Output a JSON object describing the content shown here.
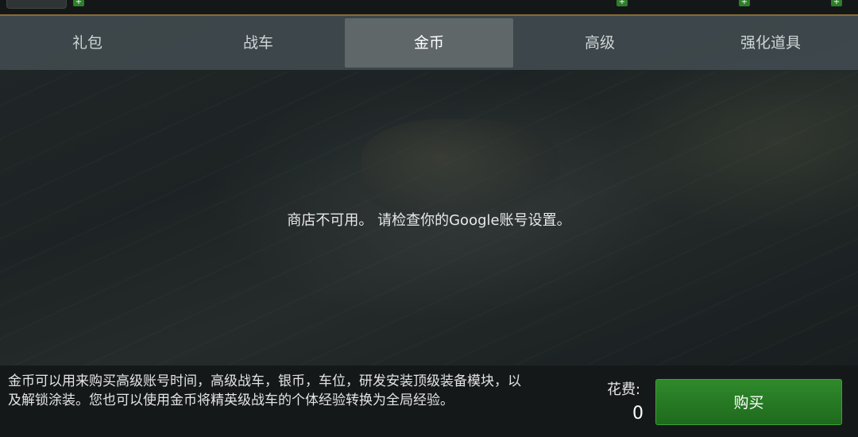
{
  "tabs": [
    {
      "label": "礼包"
    },
    {
      "label": "战车"
    },
    {
      "label": "金币"
    },
    {
      "label": "高级"
    },
    {
      "label": "强化道具"
    }
  ],
  "active_tab": "金币",
  "message": "商店不可用。 请检查你的Google账号设置。",
  "description": "金币可以用来购买高级账号时间，高级战车，银币，车位，研发安装顶级装备模块，以及解锁涂装。您也可以使用金币将精英级战车的个体经验转换为全局经验。",
  "cost": {
    "label": "花费:",
    "value": "0"
  },
  "buy_button": {
    "label": "购买"
  },
  "colors": {
    "buy": "#2a7f27",
    "tab_active": "#5f6769",
    "tab_bar": "#3e484c",
    "top_border": "#8a6a35"
  }
}
